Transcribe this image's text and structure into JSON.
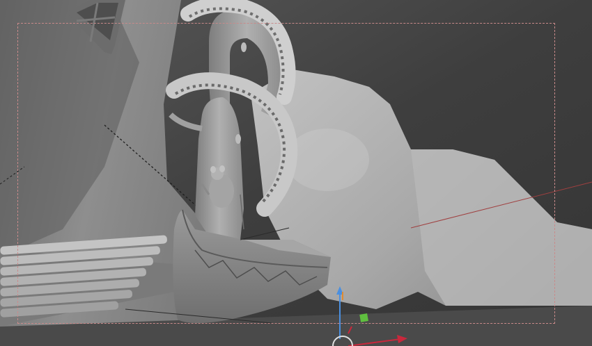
{
  "viewport": {
    "kind": "3d-viewport",
    "background_color": "#3f3f3f",
    "camera_frame_color": "#c98a8a"
  },
  "scene_objects": [
    {
      "name": "rock-cliff",
      "color": "#a9a9a9"
    },
    {
      "name": "tentacle-upper",
      "color": "#9a9a9a"
    },
    {
      "name": "tentacle-lower",
      "color": "#8f8f8f"
    },
    {
      "name": "rowboat",
      "color": "#8a8a8a"
    },
    {
      "name": "dock-planks",
      "color": "#b0b0b0"
    },
    {
      "name": "mouse-figure",
      "color": "#9d9d9d"
    },
    {
      "name": "window-frame",
      "color": "#707070"
    }
  ],
  "gizmo": {
    "axis_x_color": "#c8283c",
    "axis_y_color": "#4a8fe0",
    "axis_z_color": "#e08a30",
    "center_handle_color": "#5fbf3f",
    "ring_color": "#e0e0e0"
  }
}
